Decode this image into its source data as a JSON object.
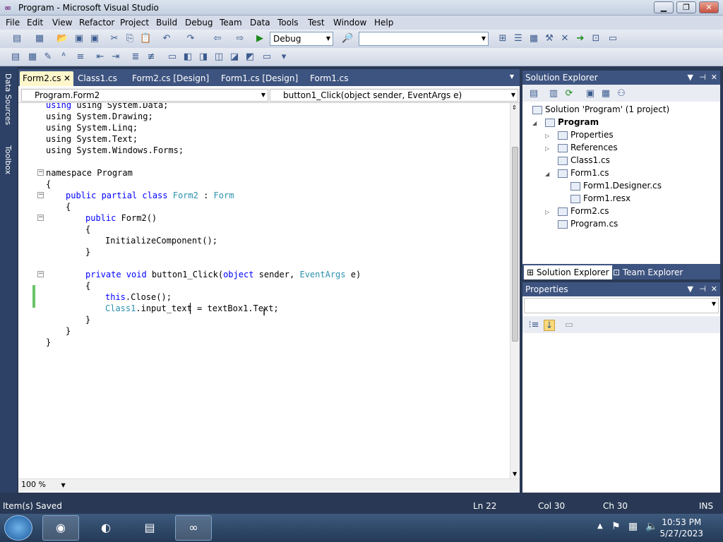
{
  "window": {
    "title": "Program - Microsoft Visual Studio",
    "icon": "vs-infinity-icon"
  },
  "menu": [
    "File",
    "Edit",
    "View",
    "Refactor",
    "Project",
    "Build",
    "Debug",
    "Team",
    "Data",
    "Tools",
    "Test",
    "Window",
    "Help"
  ],
  "toolbar": {
    "config": "Debug",
    "platform": ""
  },
  "left_strip": {
    "data_sources": "Data Sources",
    "toolbox": "Toolbox"
  },
  "tabs": [
    "Form2.cs",
    "Class1.cs",
    "Form2.cs [Design]",
    "Form1.cs [Design]",
    "Form1.cs"
  ],
  "nav": {
    "type": "Program.Form2",
    "member": "button1_Click(object sender, EventArgs e)"
  },
  "code": {
    "l1": "using System.Data;",
    "l2": "using System.Drawing;",
    "l3": "using System.Linq;",
    "l4": "using System.Text;",
    "l5": "using System.Windows.Forms;",
    "l7": "namespace Program",
    "l8": "{",
    "l9_a": "public partial class ",
    "l9_b": "Form2",
    "l9_c": " : ",
    "l9_d": "Form",
    "l10": "{",
    "l11_a": "public ",
    "l11_b": "Form2()",
    "l12": "{",
    "l13": "InitializeComponent();",
    "l14": "}",
    "l16_a": "private void ",
    "l16_b": "button1_Click(",
    "l16_c": "object",
    "l16_d": " sender, ",
    "l16_e": "EventArgs",
    "l16_f": " e)",
    "l17": "{",
    "l18_a": "this",
    "l18_b": ".Close();",
    "l19_a": "Class1",
    "l19_b": ".input_text = textBox1.Text;",
    "l20": "}",
    "l21": "}",
    "l22": "}"
  },
  "zoom": "100 %",
  "solution_explorer": {
    "title": "Solution Explorer",
    "solution": "Solution 'Program' (1 project)",
    "project": "Program",
    "items": [
      "Properties",
      "References",
      "Class1.cs",
      "Form1.cs",
      "Form1.Designer.cs",
      "Form1.resx",
      "Form2.cs",
      "Program.cs"
    ],
    "tab_solution": "Solution Explorer",
    "tab_team": "Team Explorer"
  },
  "properties": {
    "title": "Properties"
  },
  "status": {
    "message": "Item(s) Saved",
    "ln": "Ln 22",
    "col": "Col 30",
    "ch": "Ch 30",
    "mode": "INS"
  },
  "clock": {
    "time": "10:53 PM",
    "date": "5/27/2023"
  }
}
